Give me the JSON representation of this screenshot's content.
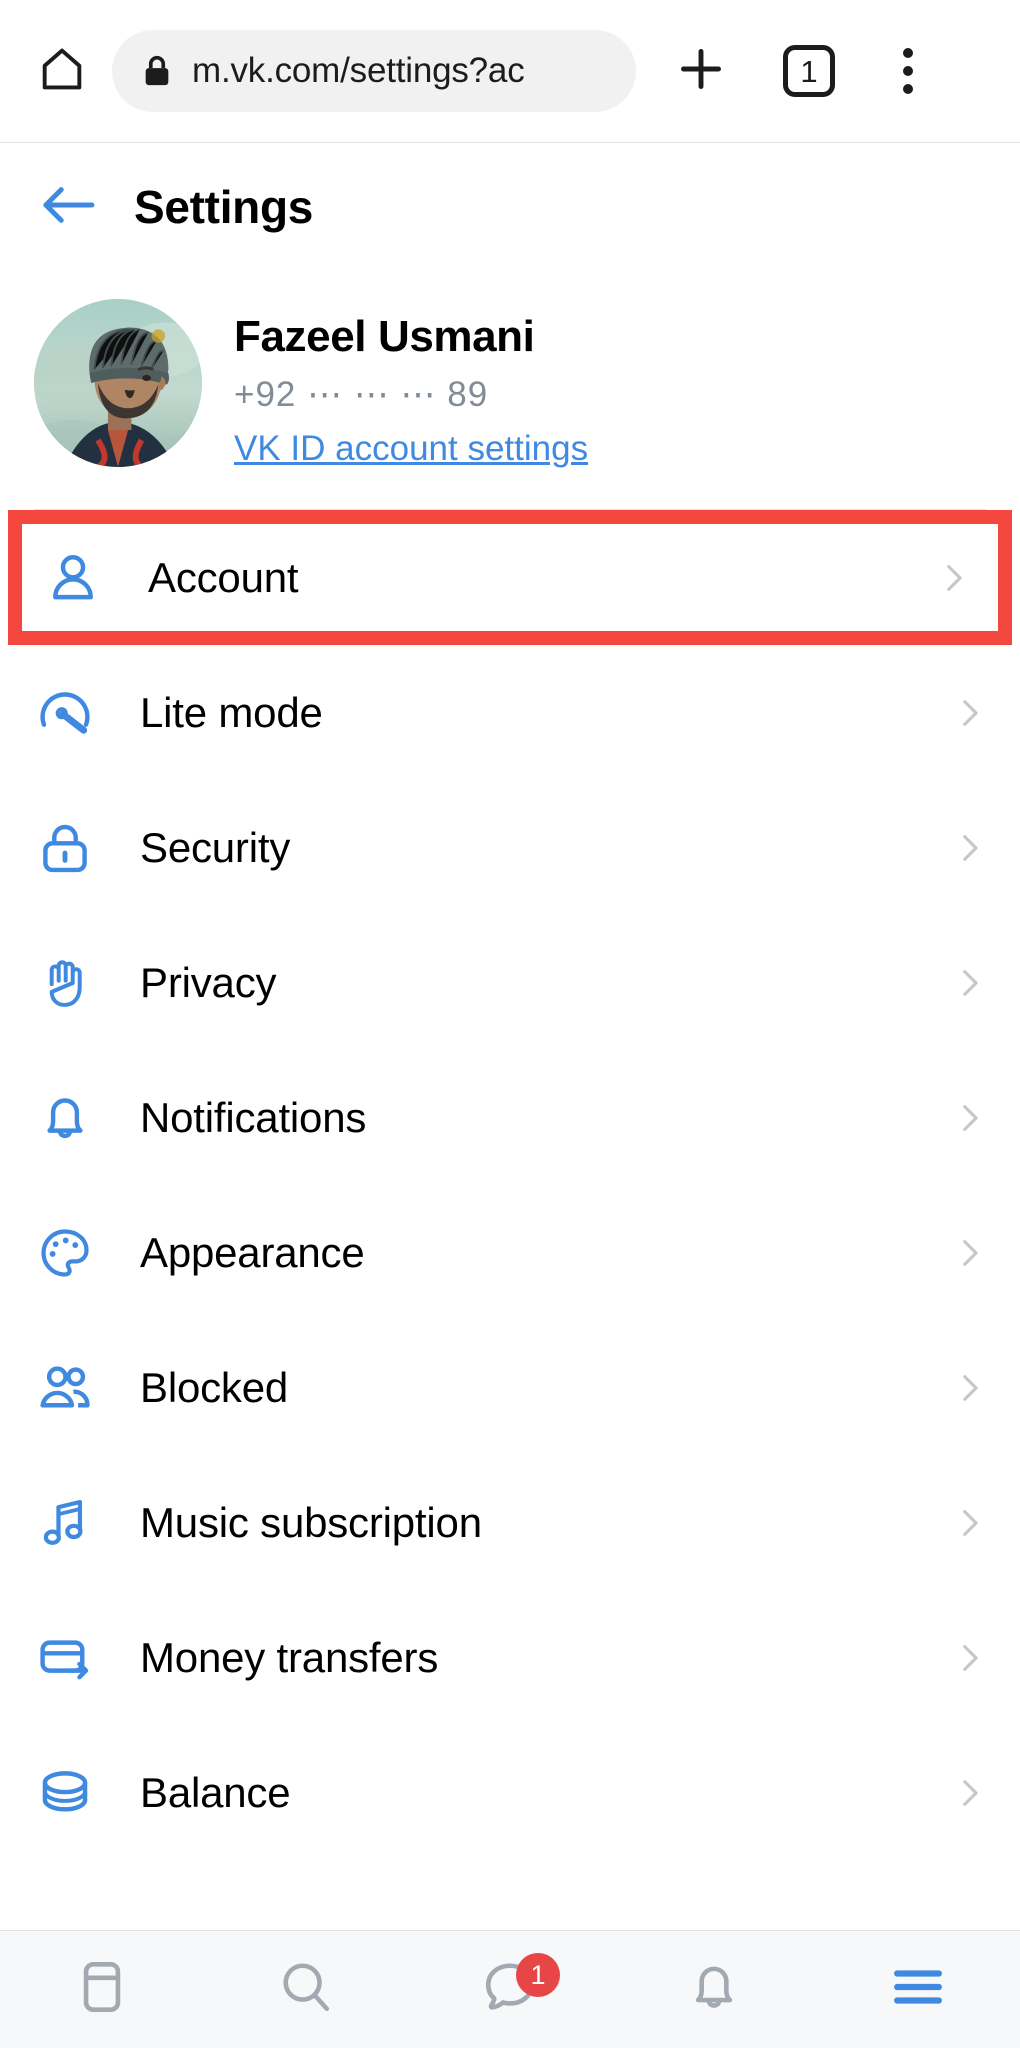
{
  "browser": {
    "home_icon": "home-icon",
    "lock_icon": "lock-icon",
    "url": "m.vk.com/settings?ac",
    "new_tab_icon": "plus-icon",
    "tab_count": "1",
    "overflow_icon": "three-dot-menu-icon"
  },
  "header": {
    "back_icon": "back-arrow-icon",
    "title": "Settings"
  },
  "profile": {
    "name": "Fazeel Usmani",
    "phone": "+92 ⋯ ⋯ ⋯ 89",
    "link": "VK ID account settings",
    "avatar_alt": "user-avatar"
  },
  "settings": {
    "items": [
      {
        "label": "Account",
        "icon": "person-icon",
        "highlighted": true
      },
      {
        "label": "Lite mode",
        "icon": "speedometer-icon",
        "highlighted": false
      },
      {
        "label": "Security",
        "icon": "lock-icon",
        "highlighted": false
      },
      {
        "label": "Privacy",
        "icon": "hand-icon",
        "highlighted": false
      },
      {
        "label": "Notifications",
        "icon": "bell-icon",
        "highlighted": false
      },
      {
        "label": "Appearance",
        "icon": "palette-icon",
        "highlighted": false
      },
      {
        "label": "Blocked",
        "icon": "people-icon",
        "highlighted": false
      },
      {
        "label": "Music subscription",
        "icon": "music-note-icon",
        "highlighted": false
      },
      {
        "label": "Money transfers",
        "icon": "card-arrow-icon",
        "highlighted": false
      },
      {
        "label": "Balance",
        "icon": "coin-icon",
        "highlighted": false
      }
    ],
    "chevron_icon": "chevron-right-icon"
  },
  "bottom_nav": {
    "items": [
      {
        "name": "feed",
        "icon": "feed-icon",
        "badge": null,
        "active": false
      },
      {
        "name": "search",
        "icon": "search-icon",
        "badge": null,
        "active": false
      },
      {
        "name": "messages",
        "icon": "message-icon",
        "badge": "1",
        "active": false
      },
      {
        "name": "notifications",
        "icon": "bell-icon",
        "badge": null,
        "active": false
      },
      {
        "name": "menu",
        "icon": "hamburger-icon",
        "badge": null,
        "active": true
      }
    ]
  },
  "colors": {
    "accent_blue": "#3f8ae0",
    "highlight_red": "#f4483f",
    "badge_red": "#e64646",
    "muted_gray": "#818c99",
    "chevron_gray": "#c4c8cc"
  }
}
